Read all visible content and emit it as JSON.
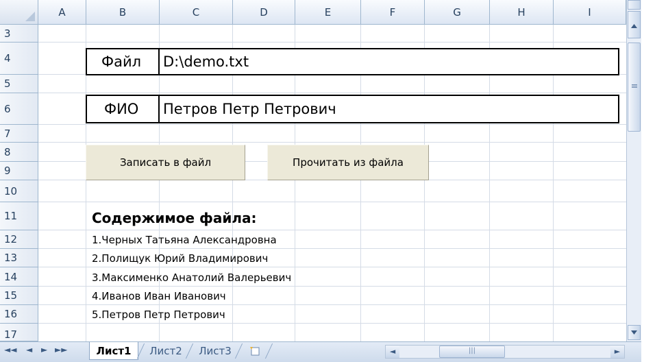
{
  "columns": [
    "A",
    "B",
    "C",
    "D",
    "E",
    "F",
    "G",
    "H",
    "I"
  ],
  "rows": [
    "3",
    "4",
    "5",
    "6",
    "7",
    "8",
    "9",
    "10",
    "11",
    "12",
    "13",
    "14",
    "15",
    "16",
    "17"
  ],
  "file_row": {
    "label": "Файл",
    "value": "D:\\demo.txt"
  },
  "fio_row": {
    "label": "ФИО",
    "value": "Петров Петр Петрович"
  },
  "buttons": {
    "write": "Записать в файл",
    "read": "Прочитать из файла"
  },
  "contents": {
    "title": "Содержимое файла:",
    "items": [
      "1.Черных Татьяна Александровна",
      "2.Полищук Юрий Владимирович",
      "3.Максименко Анатолий Валерьевич",
      "4.Иванов Иван Иванович",
      "5.Петров Петр Петрович"
    ]
  },
  "sheets": {
    "tab1": "Лист1",
    "tab2": "Лист2",
    "tab3": "Лист3"
  },
  "icons": {
    "new_sheet": "insert-sheet-icon",
    "scroll_up": "arrow-up-icon",
    "scroll_down": "arrow-down-icon"
  }
}
